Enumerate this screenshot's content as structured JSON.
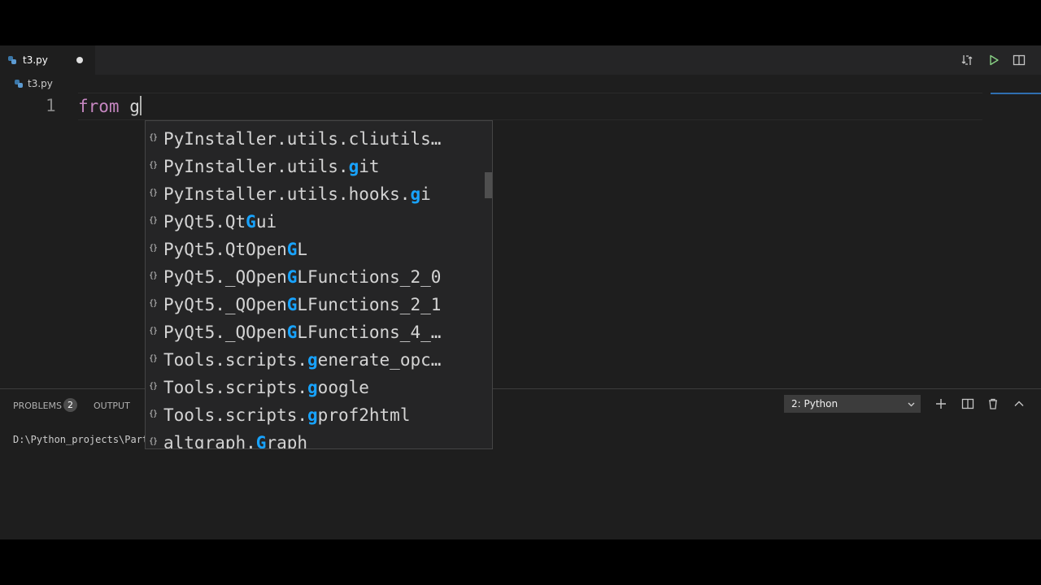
{
  "tab": {
    "label": "t3.py"
  },
  "breadcrumb": {
    "file": "t3.py"
  },
  "editor": {
    "line_number": "1",
    "keyword": "from",
    "typed": "g"
  },
  "suggestions": [
    {
      "parts": [
        "PyInstaller.utils.cliutils…"
      ]
    },
    {
      "parts": [
        "PyInstaller.utils.",
        "g",
        "it"
      ]
    },
    {
      "parts": [
        "PyInstaller.utils.hooks.",
        "g",
        "i"
      ]
    },
    {
      "parts": [
        "PyQt5.Qt",
        "G",
        "ui"
      ]
    },
    {
      "parts": [
        "PyQt5.QtOpen",
        "G",
        "L"
      ]
    },
    {
      "parts": [
        "PyQt5._QOpen",
        "G",
        "LFunctions_2_0"
      ]
    },
    {
      "parts": [
        "PyQt5._QOpen",
        "G",
        "LFunctions_2_1"
      ]
    },
    {
      "parts": [
        "PyQt5._QOpen",
        "G",
        "LFunctions_4_…"
      ]
    },
    {
      "parts": [
        "Tools.scripts.",
        "g",
        "enerate_opc…"
      ]
    },
    {
      "parts": [
        "Tools.scripts.",
        "g",
        "oogle"
      ]
    },
    {
      "parts": [
        "Tools.scripts.",
        "g",
        "prof2html"
      ]
    },
    {
      "parts": [
        "altgraph.",
        "G",
        "raph"
      ]
    }
  ],
  "suggest_icon_glyph": "{}",
  "panel": {
    "problems_label": "PROBLEMS",
    "problems_count": "2",
    "output_label": "OUTPUT",
    "terminal_selector": "2: Python",
    "terminal_text": "D:\\Python_projects\\Part"
  },
  "icons": {
    "tab_file": "python-icon",
    "toolbar": [
      "open-changes-icon",
      "run-icon",
      "split-editor-icon"
    ],
    "panel": [
      "add-terminal-icon",
      "split-terminal-icon",
      "trash-icon",
      "maximize-panel-icon"
    ]
  },
  "colors": {
    "editor_bg": "#1e1e1e",
    "keyword": "#c586c0",
    "match_highlight": "#18a3ff",
    "run_icon": "#89d185"
  }
}
